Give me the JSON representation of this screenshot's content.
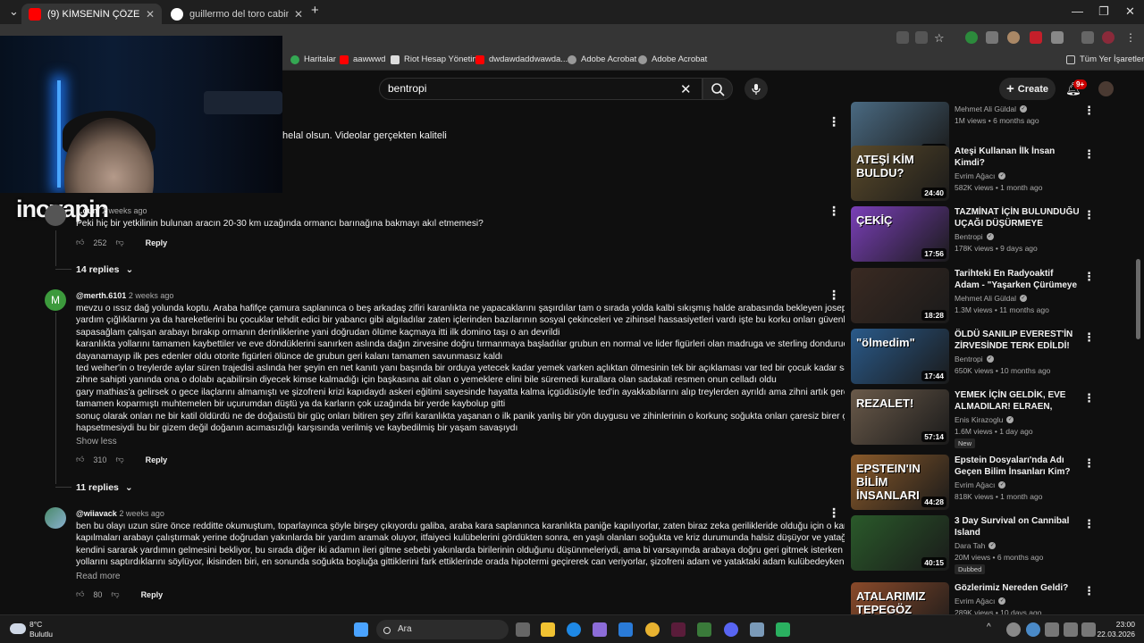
{
  "browser": {
    "tabs": [
      {
        "title": "(9) KİMSENİN ÇÖZEMEDİĞİ TA",
        "active": true
      },
      {
        "title": "guillermo del toro cabinet of cu",
        "active": false
      }
    ],
    "new_tab": "+",
    "bookmarks": [
      {
        "label": "Haritalar",
        "icon": "map-pin-icon"
      },
      {
        "label": "aawwwd",
        "icon": "youtube-icon"
      },
      {
        "label": "Riot Hesap Yönetimi",
        "icon": "riot-icon"
      },
      {
        "label": "dwdawdaddwawda...",
        "icon": "youtube-icon"
      },
      {
        "label": "Adobe Acrobat",
        "icon": "globe-icon"
      },
      {
        "label": "Adobe Acrobat",
        "icon": "globe-icon"
      }
    ],
    "all_bookmarks": "Tüm Yer İşaretleri"
  },
  "overlay": {
    "watermark": "inovapin"
  },
  "youtube": {
    "search_value": "bentropi",
    "create_label": "Create",
    "notification_count": "9+"
  },
  "comments": {
    "partial_text": "helal olsun. Videolar gerçekten kaliteli",
    "first": {
      "author": "...ouni",
      "time": "2 weeks ago",
      "text": "Peki hiç bir yetkilinin bulunan aracın 20-30 km uzağında ormancı barınağına bakmayı akıl etmemesi?",
      "likes": "252",
      "reply_label": "Reply",
      "replies_label": "14 replies"
    },
    "second": {
      "avatar_letter": "M",
      "author": "@merth.6101",
      "time": "2 weeks ago",
      "lines": [
        "mevzu o ıssız dağ yolunda koptu. Araba hafifçe çamura saplanınca o beş arkadaş zifiri karanlıkta ne yapacaklarını şaşırdılar tam o sırada yolda kalbi sıkışmış halde arabasında bekleyen joseph schons'un",
        "yardım çığlıklarını ya da hareketlerini bu çocuklar tehdit edici bir yabancı gibi algıladılar zaten içlerinden bazılarının sosyal çekinceleri ve zihinsel hassasiyetleri vardı işte bu korku onları güvenli sıcak ve",
        "sapasağlam çalışan arabayı bırakıp ormanın derinliklerine yani doğrudan ölüme kaçmaya itti ilk domino taşı o an devrildi",
        "karanlıkta yollarını tamamen kaybettiler ve eve döndüklerini sanırken aslında dağın zirvesine doğru tırmanmaya başladılar grubun en normal ve lider figürleri olan madruga ve sterling dondurucu soğuğa",
        "dayanamayıp ilk pes edenler oldu otorite figürleri ölünce de grubun geri kalanı tamamen savunmasız kaldı",
        "ted weiher'in o treylerde aylar süren trajedisi aslında her şeyin en net kanıtı yanı başında bir orduya yetecek kadar yemek varken açlıktan ölmesinin tek bir açıklaması var ted bir çocuk kadar saf ve kuralcı bir",
        "zihne sahipti yanında ona o dolabı açabilirsin diyecek kimse kalmadığı için başkasına ait olan o yemeklere elini bile süremedi kurallara olan sadakati resmen onun celladı oldu",
        "gary mathias'a gelirsek o gece ilaçlarını almamıştı ve şizofreni krizi kapıdaydı askeri eğitimi sayesinde hayatta kalma içgüdüsüyle ted'in ayakkabılarını alıp treylerden ayrıldı ama zihni artık gerçeklikle bağını",
        "tamamen koparmıştı muhtemelen bir uçurumdan düştü ya da karların çok uzağında bir yerde kaybolup gitti",
        "sonuç olarak onları ne bir katil öldürdü ne de doğaüstü bir güç onları bitiren şey zifiri karanlıkta yaşanan o ilk panik yanlış bir yön duygusu ve zihinlerinin o korkunç soğukta onları çaresiz birer çocuk gibi",
        "hapsetmesiydi bu bir gizem değil doğanın acımasızlığı karşısında verilmiş ve kaybedilmiş bir yaşam savaşıydı"
      ],
      "show_less": "Show less",
      "likes": "310",
      "reply_label": "Reply",
      "replies_label": "11 replies"
    },
    "third": {
      "author": "@wiiavack",
      "time": "2 weeks ago",
      "lines": [
        "ben bu olayı uzun süre önce redditte okumuştum, toparlayınca şöyle birşey çıkıyordu galiba, araba kara saplanınca karanlıkta paniğe kapılıyorlar, zaten biraz zeka gerilikleride olduğu için o karanlıkta paniğe",
        "kapılmaları arabayı çalıştırmak yerine doğrudan yakınlarda bir yardım aramak oluyor, itfaiyeci kulübelerini gördükten sonra, en yaşlı olanları soğukta ve kriz durumunda halsiz düşüyor ve yatağa donmamak için",
        "kendini sararak yardımın gelmesini bekliyor, bu sırada diğer iki adamın ileri gitme sebebi yakınlarda birilerinin olduğunu düşünmeleriydi, ama bi varsayımda arabaya doğru geri gitmek isterken yanlışlıkla",
        "yollarını saptırdıklarını söylüyor, ikisinden biri, en sonunda soğukta boşluğa gittiklerini fark ettiklerinde orada hipotermi geçirerek can veriyorlar, şizofreni adam ve yataktaki adam kulübedeyken, halihazırda .."
      ],
      "read_more": "Read more",
      "likes": "80",
      "reply_label": "Reply"
    }
  },
  "sidebar": [
    {
      "title": "",
      "channel": "Mehmet Ali Güldal",
      "meta": "1M views • 6 months ago",
      "duration": "22:17",
      "thumb_color": "#4a6a82",
      "thumb_text": ""
    },
    {
      "title": "Ateşi Kullanan İlk İnsan Kimdi?",
      "channel": "Evrim Ağacı",
      "meta": "582K views • 1 month ago",
      "duration": "24:40",
      "thumb_color": "#5a4a2a",
      "thumb_text": "ATEŞİ KİM BULDU?"
    },
    {
      "title": "TAZMİNAT İÇİN BULUNDUĞU UÇAĞI DÜŞÜRMEYE ÇALIŞAN ...",
      "channel": "Bentropi",
      "meta": "178K views • 9 days ago",
      "duration": "17:56",
      "thumb_color": "#7a3fb8",
      "thumb_text": "ÇEKİÇ"
    },
    {
      "title": "Tarihteki En Radyoaktif Adam - \"Yaşarken Çürümeye Başladı\"",
      "channel": "Mehmet Ali Güldal",
      "meta": "1.3M views • 11 months ago",
      "duration": "18:28",
      "thumb_color": "#3a2a22",
      "thumb_text": ""
    },
    {
      "title": "ÖLDÜ SANILIP EVEREST'İN ZİRVESİNDE TERK EDİLDİ!",
      "channel": "Bentropi",
      "meta": "650K views • 10 months ago",
      "duration": "17:44",
      "thumb_color": "#2a5a8a",
      "thumb_text": "\"ölmedim\""
    },
    {
      "title": "YEMEK İÇİN GELDİK, EVE ALMADILAR! ELRAEN, ERAY, ...",
      "channel": "Enis Kirazoglu",
      "meta": "1.6M views • 1 day ago",
      "duration": "57:14",
      "thumb_color": "#6a5a4a",
      "thumb_text": "REZALET!",
      "badge": "New"
    },
    {
      "title": "Epstein Dosyaları'nda Adı Geçen Bilim İnsanları Kim?",
      "channel": "Evrim Ağacı",
      "meta": "818K views • 1 month ago",
      "duration": "44:28",
      "thumb_color": "#8a5a2a",
      "thumb_text": "EPSTEIN'IN BİLİM İNSANLARI"
    },
    {
      "title": "3 Day Survival on Cannibal Island",
      "channel": "Dara Tah",
      "meta": "20M views • 6 months ago",
      "duration": "40:15",
      "thumb_color": "#2a5a2a",
      "thumb_text": "",
      "badge": "Dubbed"
    },
    {
      "title": "Gözlerimiz Nereden Geldi?",
      "channel": "Evrim Ağacı",
      "meta": "289K views • 10 days ago",
      "duration": "",
      "thumb_color": "#8a4a2a",
      "thumb_text": "ATALARIMIZ TEPEGÖZ"
    }
  ],
  "taskbar": {
    "temperature": "8°C",
    "weather": "Bulutlu",
    "search_placeholder": "Ara",
    "time": "23:00",
    "date": "22.03.2026"
  }
}
